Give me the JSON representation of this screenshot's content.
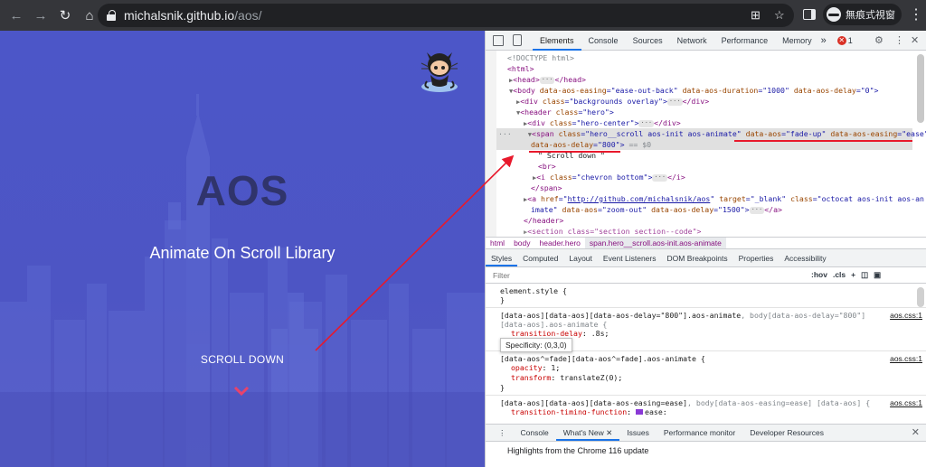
{
  "browser": {
    "url_host": "michalsnik.github.io",
    "url_path": "/aos/",
    "profile_label": "無痕式視窗"
  },
  "page": {
    "title": "AOS",
    "subtitle": "Animate On Scroll Library",
    "scroll_down": "SCROLL DOWN"
  },
  "devtools": {
    "tabs": [
      "Elements",
      "Console",
      "Sources",
      "Network",
      "Performance",
      "Memory"
    ],
    "more_tabs": "»",
    "error_count": "1",
    "dom_lines": {
      "l0": "<!DOCTYPE html>",
      "l1": "<html>",
      "l2a": "<head>",
      "l2b": "</head>",
      "l3a": "<body ",
      "l3b": "data-aos-easing",
      "l3c": "=\"ease-out-back\" ",
      "l3d": "data-aos-duration",
      "l3e": "=\"1000\" ",
      "l3f": "data-aos-delay",
      "l3g": "=\"0\">",
      "l4a": "<div ",
      "l4b": "class",
      "l4c": "=\"backgrounds overlay\">",
      "l4d": "</div>",
      "l5a": "<header ",
      "l5b": "class",
      "l5c": "=\"hero\">",
      "l6a": "<div ",
      "l6b": "class",
      "l6c": "=\"hero-center\">",
      "l6d": "</div>",
      "l7a": "<span ",
      "l7b": "class",
      "l7c": "=\"hero__scroll aos-init aos-animate\" ",
      "l7d": "data-aos",
      "l7e": "=\"fade-up\" ",
      "l7f": "data-aos-easing",
      "l7g": "=\"ease\"",
      "l8a": "data-aos-delay",
      "l8b": "=\"800\">",
      "l8c": " == $0",
      "l9": "\" Scroll down \"",
      "l10": "<br>",
      "l11a": "<i ",
      "l11b": "class",
      "l11c": "=\"chevron bottom\">",
      "l11d": "</i>",
      "l12": "</span>",
      "l13a": "<a ",
      "l13b": "href",
      "l13c": "=\"",
      "l13d": "http://github.com/michalsnik/aos",
      "l13e": "\" ",
      "l13f": "target",
      "l13g": "=\"_blank\" ",
      "l13h": "class",
      "l13i": "=\"octocat aos-init aos-an",
      "l14a": "imate\" ",
      "l14b": "data-aos",
      "l14c": "=\"zoom-out\" ",
      "l14d": "data-aos-delay",
      "l14e": "=\"1500\">",
      "l14f": "</a>",
      "l15": "</header>",
      "l16": "<section class=\"section section--code\">"
    },
    "breadcrumbs": [
      "html",
      "body",
      "header.hero",
      "span.hero__scroll.aos-init.aos-animate"
    ],
    "sub_tabs": [
      "Styles",
      "Computed",
      "Layout",
      "Event Listeners",
      "DOM Breakpoints",
      "Properties",
      "Accessibility"
    ],
    "filter_placeholder": "Filter",
    "filter_hov": ":hov",
    "filter_cls": ".cls",
    "styles": {
      "r1_sel": "element.style {",
      "r1_end": "}",
      "r2_sel_a": "[data-aos][data-aos][data-aos-delay=\"800\"].aos-animate",
      "r2_sel_b": ", body[data-aos-delay=\"800\"]",
      "r2_sel_c": "[data-aos].aos-animate {",
      "r2_src": "aos.css:1",
      "r2_prop": "transition-delay",
      "r2_val": ".8s",
      "tooltip": "Specificity: (0,3,0)",
      "r3_sel": "[data-aos^=fade][data-aos^=fade].aos-animate {",
      "r3_src": "aos.css:1",
      "r3_p1": "opacity",
      "r3_v1": "1",
      "r3_p2": "transform",
      "r3_v2": "translateZ(0)",
      "r4_sel_a": "[data-aos][data-aos][data-aos-easing=ease]",
      "r4_sel_b": ", body[data-aos-easing=ease] [data-aos] {",
      "r4_src": "aos.css:1",
      "r4_prop": "transition-timing-function",
      "r4_val": "ease",
      "close_brace": "}"
    },
    "drawer_tabs": [
      "Console",
      "What's New",
      "Issues",
      "Performance monitor",
      "Developer Resources"
    ],
    "drawer_highlight": "Highlights from the Chrome 116 update"
  },
  "colors": {
    "accent": "#1a73e8",
    "annotation": "#e8192c",
    "hero_bg": "#4c56c8",
    "chevron": "#e8436b"
  }
}
